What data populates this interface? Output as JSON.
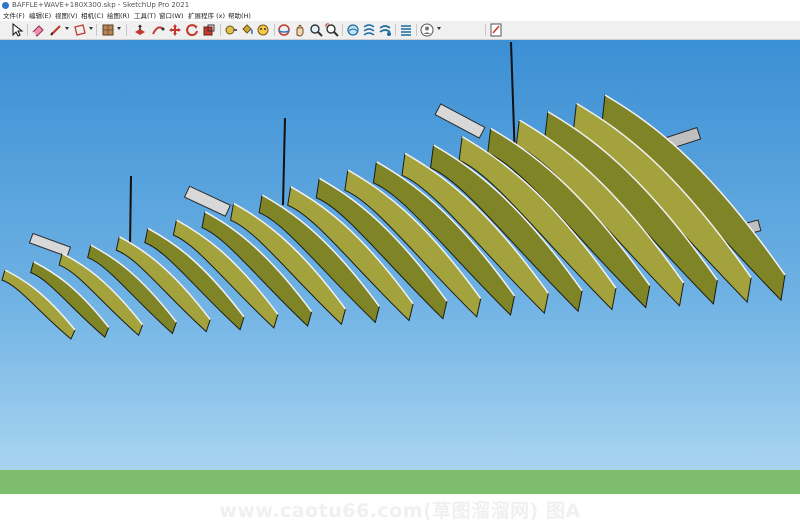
{
  "window": {
    "title": "BAFFLE+WAVE+180X300.skp - SketchUp Pro 2021"
  },
  "menu": {
    "items": [
      "文件(F)",
      "编辑(E)",
      "视图(V)",
      "相机(C)",
      "绘图(R)",
      "工具(T)",
      "窗口(W)",
      "扩展程序 (x)",
      "帮助(H)"
    ]
  },
  "toolbar": {
    "tools": [
      "select-icon",
      "eraser-icon",
      "line-pencil-icon",
      "shape-icon",
      "material-icon",
      "push-pull-icon",
      "follow-me-icon",
      "move-icon",
      "rotate-icon",
      "scale-icon",
      "tape-measure-icon",
      "paint-bucket-icon",
      "orbit-icon",
      "pan-icon",
      "zoom-icon",
      "zoom-extents-icon",
      "sandbox-icon",
      "section-icon",
      "layers-icon",
      "user-icon",
      "model-info-icon"
    ]
  },
  "watermark": {
    "text": "www.caotu66.com(草图溜溜网) 图A"
  },
  "colors": {
    "sky_top": "#3b8fd4",
    "sky_bottom": "#a3d0ef",
    "ground": "#7ebd6c",
    "panel": "#7f8427",
    "panel_face": "#a3a23c"
  }
}
